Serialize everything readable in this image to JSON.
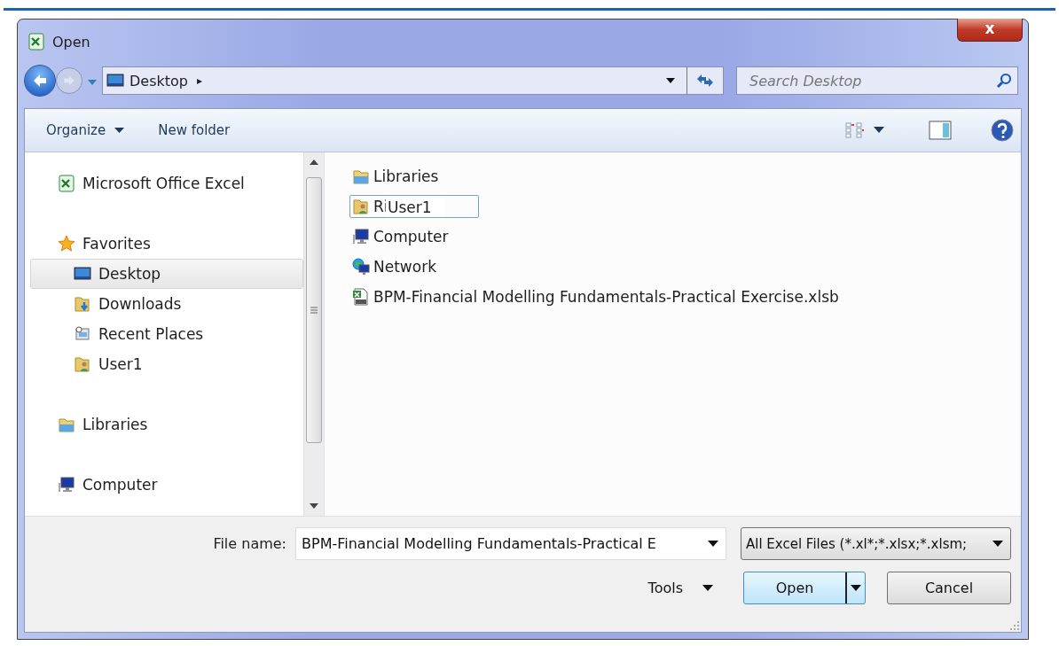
{
  "window": {
    "title": "Open",
    "close_label": "x"
  },
  "address_bar": {
    "location": "Desktop",
    "separator": "▸"
  },
  "search": {
    "placeholder": "Search Desktop"
  },
  "toolbar": {
    "buttons": [
      {
        "label": "Organize",
        "menu": true
      },
      {
        "label": "New folder",
        "menu": false
      }
    ]
  },
  "sidebar": {
    "sections": [
      {
        "label": "Microsoft Office Excel",
        "kind": "excel",
        "selected": false
      },
      {
        "label": "Favorites",
        "kind": "star",
        "selected": false,
        "children": [
          {
            "label": "Desktop",
            "kind": "desktop",
            "selected": true
          },
          {
            "label": "Downloads",
            "kind": "downloads",
            "selected": false
          },
          {
            "label": "Recent Places",
            "kind": "recent",
            "selected": false
          },
          {
            "label": "User1",
            "kind": "user",
            "selected": false
          }
        ]
      },
      {
        "label": "Libraries",
        "kind": "libraries",
        "selected": false
      },
      {
        "label": "Computer",
        "kind": "computer",
        "selected": false
      }
    ]
  },
  "files": [
    {
      "label": "Libraries",
      "kind": "libraries",
      "selected": false
    },
    {
      "label": "Ri",
      "kind": "user",
      "selected": true,
      "overlay_label": "User1"
    },
    {
      "label": "Computer",
      "kind": "computer",
      "selected": false
    },
    {
      "label": "Network",
      "kind": "network",
      "selected": false
    },
    {
      "label": "BPM-Financial Modelling Fundamentals-Practical Exercise.xlsb",
      "kind": "excel-file",
      "selected": false
    }
  ],
  "footer": {
    "file_name_label": "File name:",
    "file_name": "BPM-Financial Modelling Fundamentals-Practical E",
    "filter": "All Excel Files (*.xl*;*.xlsx;*.xlsm;",
    "tools_label": "Tools",
    "open_label": "Open",
    "cancel_label": "Cancel"
  }
}
